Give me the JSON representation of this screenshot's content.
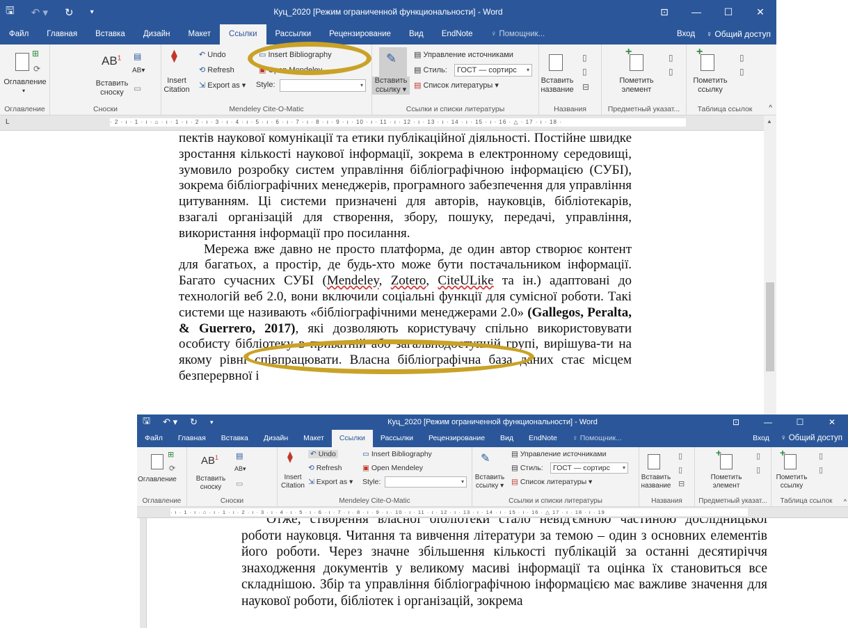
{
  "colors": {
    "title_bar": "#2b579a",
    "ribbon_bg": "#f3f3f3",
    "highlight_oval": "#c9a227"
  },
  "window": {
    "title": "Куц_2020 [Режим ограниченной функциональности] - Word",
    "controls": {
      "ribbon_options": "⊡",
      "minimize": "—",
      "maximize": "☐",
      "close": "✕"
    }
  },
  "tabs": [
    "Файл",
    "Главная",
    "Вставка",
    "Дизайн",
    "Макет",
    "Ссылки",
    "Рассылки",
    "Рецензирование",
    "Вид",
    "EndNote"
  ],
  "active_tab": "Ссылки",
  "tell_me": "♀ Помощник...",
  "signin": "Вход",
  "share": "♀ Общий доступ",
  "ribbon": {
    "toc": {
      "button": "Оглавление",
      "group": "Оглавление"
    },
    "footnotes": {
      "insert_footnote_1": "Вставить",
      "insert_footnote_2": "сноску",
      "group": "Сноски",
      "ab": "AB",
      "sup": "1"
    },
    "mendeley": {
      "undo": "Undo",
      "refresh": "Refresh",
      "insert_citation_1": "Insert",
      "insert_citation_2": "Citation",
      "export_as": "Export as ▾",
      "style_label": "Style:",
      "insert_bibliography": "Insert Bibliography",
      "open_mendeley": "Open Mendeley",
      "group": "Mendeley Cite-O-Matic"
    },
    "citations": {
      "insert_1": "Вставить",
      "insert_2": "ссылку ▾",
      "manage_sources": "Управление источниками",
      "style_label": "Стиль:",
      "style_value": "ГОСТ — сортирс",
      "bibliography": "Список литературы ▾",
      "group": "Ссылки и списки литературы"
    },
    "captions": {
      "insert_1": "Вставить",
      "insert_2": "название",
      "group": "Названия"
    },
    "index": {
      "mark_1": "Пометить",
      "mark_2": "элемент",
      "group": "Предметный указат..."
    },
    "toa": {
      "mark_1": "Пометить",
      "mark_2": "ссылку",
      "group": "Таблица ссылок"
    }
  },
  "ruler1": "· 2 · ı · 1 · ı · ⌂ · ı · 1 · ı · 2 · ı · 3 · ı · 4 · ı · 5 · ı · 6 · ı · 7 · ı · 8 · ı · 9 · ı · 10 · ı · 11 · ı · 12 · ı · 13 · ı · 14 · ı · 15 · ı · 16 · △ · 17 · ı · 18 ·",
  "ruler2": "· ı · 1 · ı · ⌂ · ı · 1 · ı · 2 · ı · 3 · ı · 4 · ı · 5 · ı · 6 · ı · 7 · ı · 8 · ı · 9 · ı · 10 · ı · 11 · ı · 12 · ı · 13 · ı · 14 · ı · 15 · ı · 16 · △ 17 · ı · 18 · ı · 19",
  "doc1": {
    "p1": "пектів наукової комунікації та етики публікаційної діяльності. Постійне швидке зростання кількості наукової інформації, зокрема в електронному середовищі, зумовило розробку систем управління бібліографічною інформацією (СУБІ), зокрема бібліографічних менеджерів, програмного забезпечення для управління цитуванням. Ці системи призначені для авторів, науковців, бібліотекарів, взагалі організацій для створення, збору, пошуку, передачі, управління, використання інформації про посилання.",
    "p2a": "Мережа вже давно не просто платформа, де один автор створює контент для багатьох, а простір, де будь-хто може бути постачальником інформації. Багато сучасних СУБІ (",
    "m1": "Mendeley",
    "sep1": ", ",
    "m2": "Zotero",
    "sep2": ", ",
    "m3": "CiteULike",
    "p2b": " та ін.) адаптовані до технологій веб 2.0, вони включили соціальні функції для сумісної роботи. Такі системи ще називають «бібліографічними менеджерами 2.0» ",
    "citation": "(Gallegos, Peralta, & Guerrero, 2017)",
    "p2c": ", які дозволяють користувачу спільно використовувати особисту бібліотеку в приватній або загальнодоступній групі, вирішува-ти на якому рівні співпрацювати. Власна бібліографічна база даних стає місцем безперервної і"
  },
  "doc2": {
    "p1": "Отже, створення власної бібліотеки стало невід'ємною частиною дослідницької роботи науковця. Читання та вивчення літератури за темою – один з основних елементів його роботи. Через значне збільшення кількості публікацій за останні десятиріччя знаходження документів у великому масиві інформації та оцінка їх становиться все складнішою. Збір та управління бібліографічною інформацією має важливе значення для наукової роботи, бібліотек і організацій, зокрема"
  }
}
